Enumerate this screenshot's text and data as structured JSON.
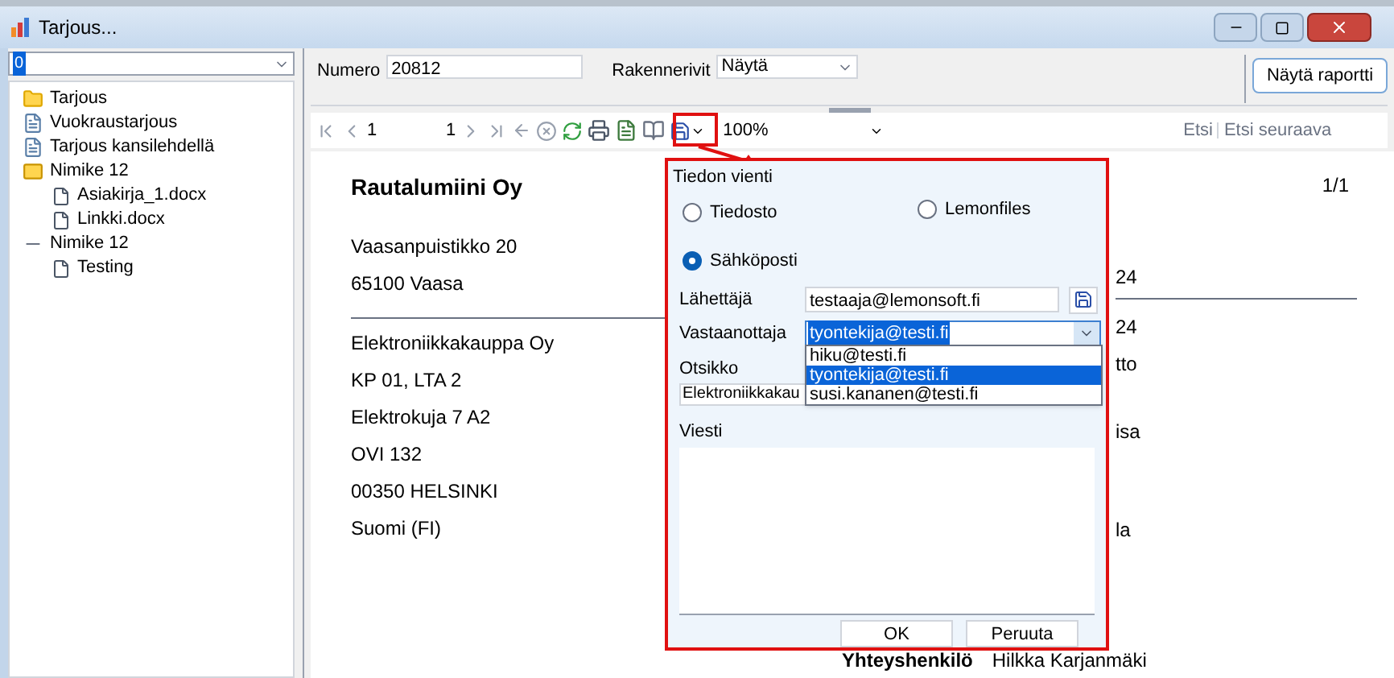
{
  "window": {
    "title": "Tarjous..."
  },
  "sidebar": {
    "selector_value": "0",
    "tree": [
      {
        "label": "Tarjous",
        "kind": "folder"
      },
      {
        "label": "Vuokraustarjous",
        "kind": "report"
      },
      {
        "label": "Tarjous kansilehdellä",
        "kind": "report"
      },
      {
        "label": "Nimike 12",
        "kind": "group",
        "children": [
          {
            "label": "Asiakirja_1.docx",
            "kind": "file"
          },
          {
            "label": "Linkki.docx",
            "kind": "file"
          }
        ]
      },
      {
        "label": "Nimike 12",
        "kind": "line",
        "children": [
          {
            "label": "Testing",
            "kind": "file"
          }
        ]
      }
    ]
  },
  "header": {
    "number_label": "Numero",
    "number_value": "20812",
    "rows_label": "Rakennerivit",
    "rows_value": "Näytä",
    "show_button": "Näytä raportti"
  },
  "toolbar": {
    "page": "1",
    "page_count": "1",
    "zoom": "100%",
    "find": "Etsi",
    "find_next": "Etsi seuraava"
  },
  "report": {
    "company": "Rautalumiini Oy",
    "page_indicator": "1/1",
    "sender_lines": [
      "Vaasanpuistikko 20",
      "65100 Vaasa"
    ],
    "recipient_lines": [
      "Elektroniikkakauppa Oy",
      "KP 01, LTA 2",
      "Elektrokuja 7 A2",
      "OVI 132",
      "00350  HELSINKI",
      "Suomi (FI)"
    ],
    "right_fragments": [
      "24",
      "24",
      "tto",
      "isa",
      "la"
    ],
    "contact_label": "Yhteyshenkilö",
    "contact_name": "Hilkka Karjanmäki"
  },
  "dialog": {
    "group_title": "Tiedon vienti",
    "targets": [
      {
        "label": "Tiedosto",
        "selected": false
      },
      {
        "label": "Lemonfiles",
        "selected": false
      },
      {
        "label": "Sähköposti",
        "selected": true
      }
    ],
    "sender_label": "Lähettäjä",
    "sender_value": "testaaja@lemonsoft.fi",
    "recipient_label": "Vastaanottaja",
    "recipient_value": "tyontekija@testi.fi",
    "recipient_options": [
      {
        "label": "hiku@testi.fi",
        "selected": false
      },
      {
        "label": "tyontekija@testi.fi",
        "selected": true
      },
      {
        "label": "susi.kananen@testi.fi",
        "selected": false
      }
    ],
    "subject_label": "Otsikko",
    "subject_value": "Elektroniikkakau",
    "message_label": "Viesti",
    "ok": "OK",
    "cancel": "Peruuta"
  }
}
